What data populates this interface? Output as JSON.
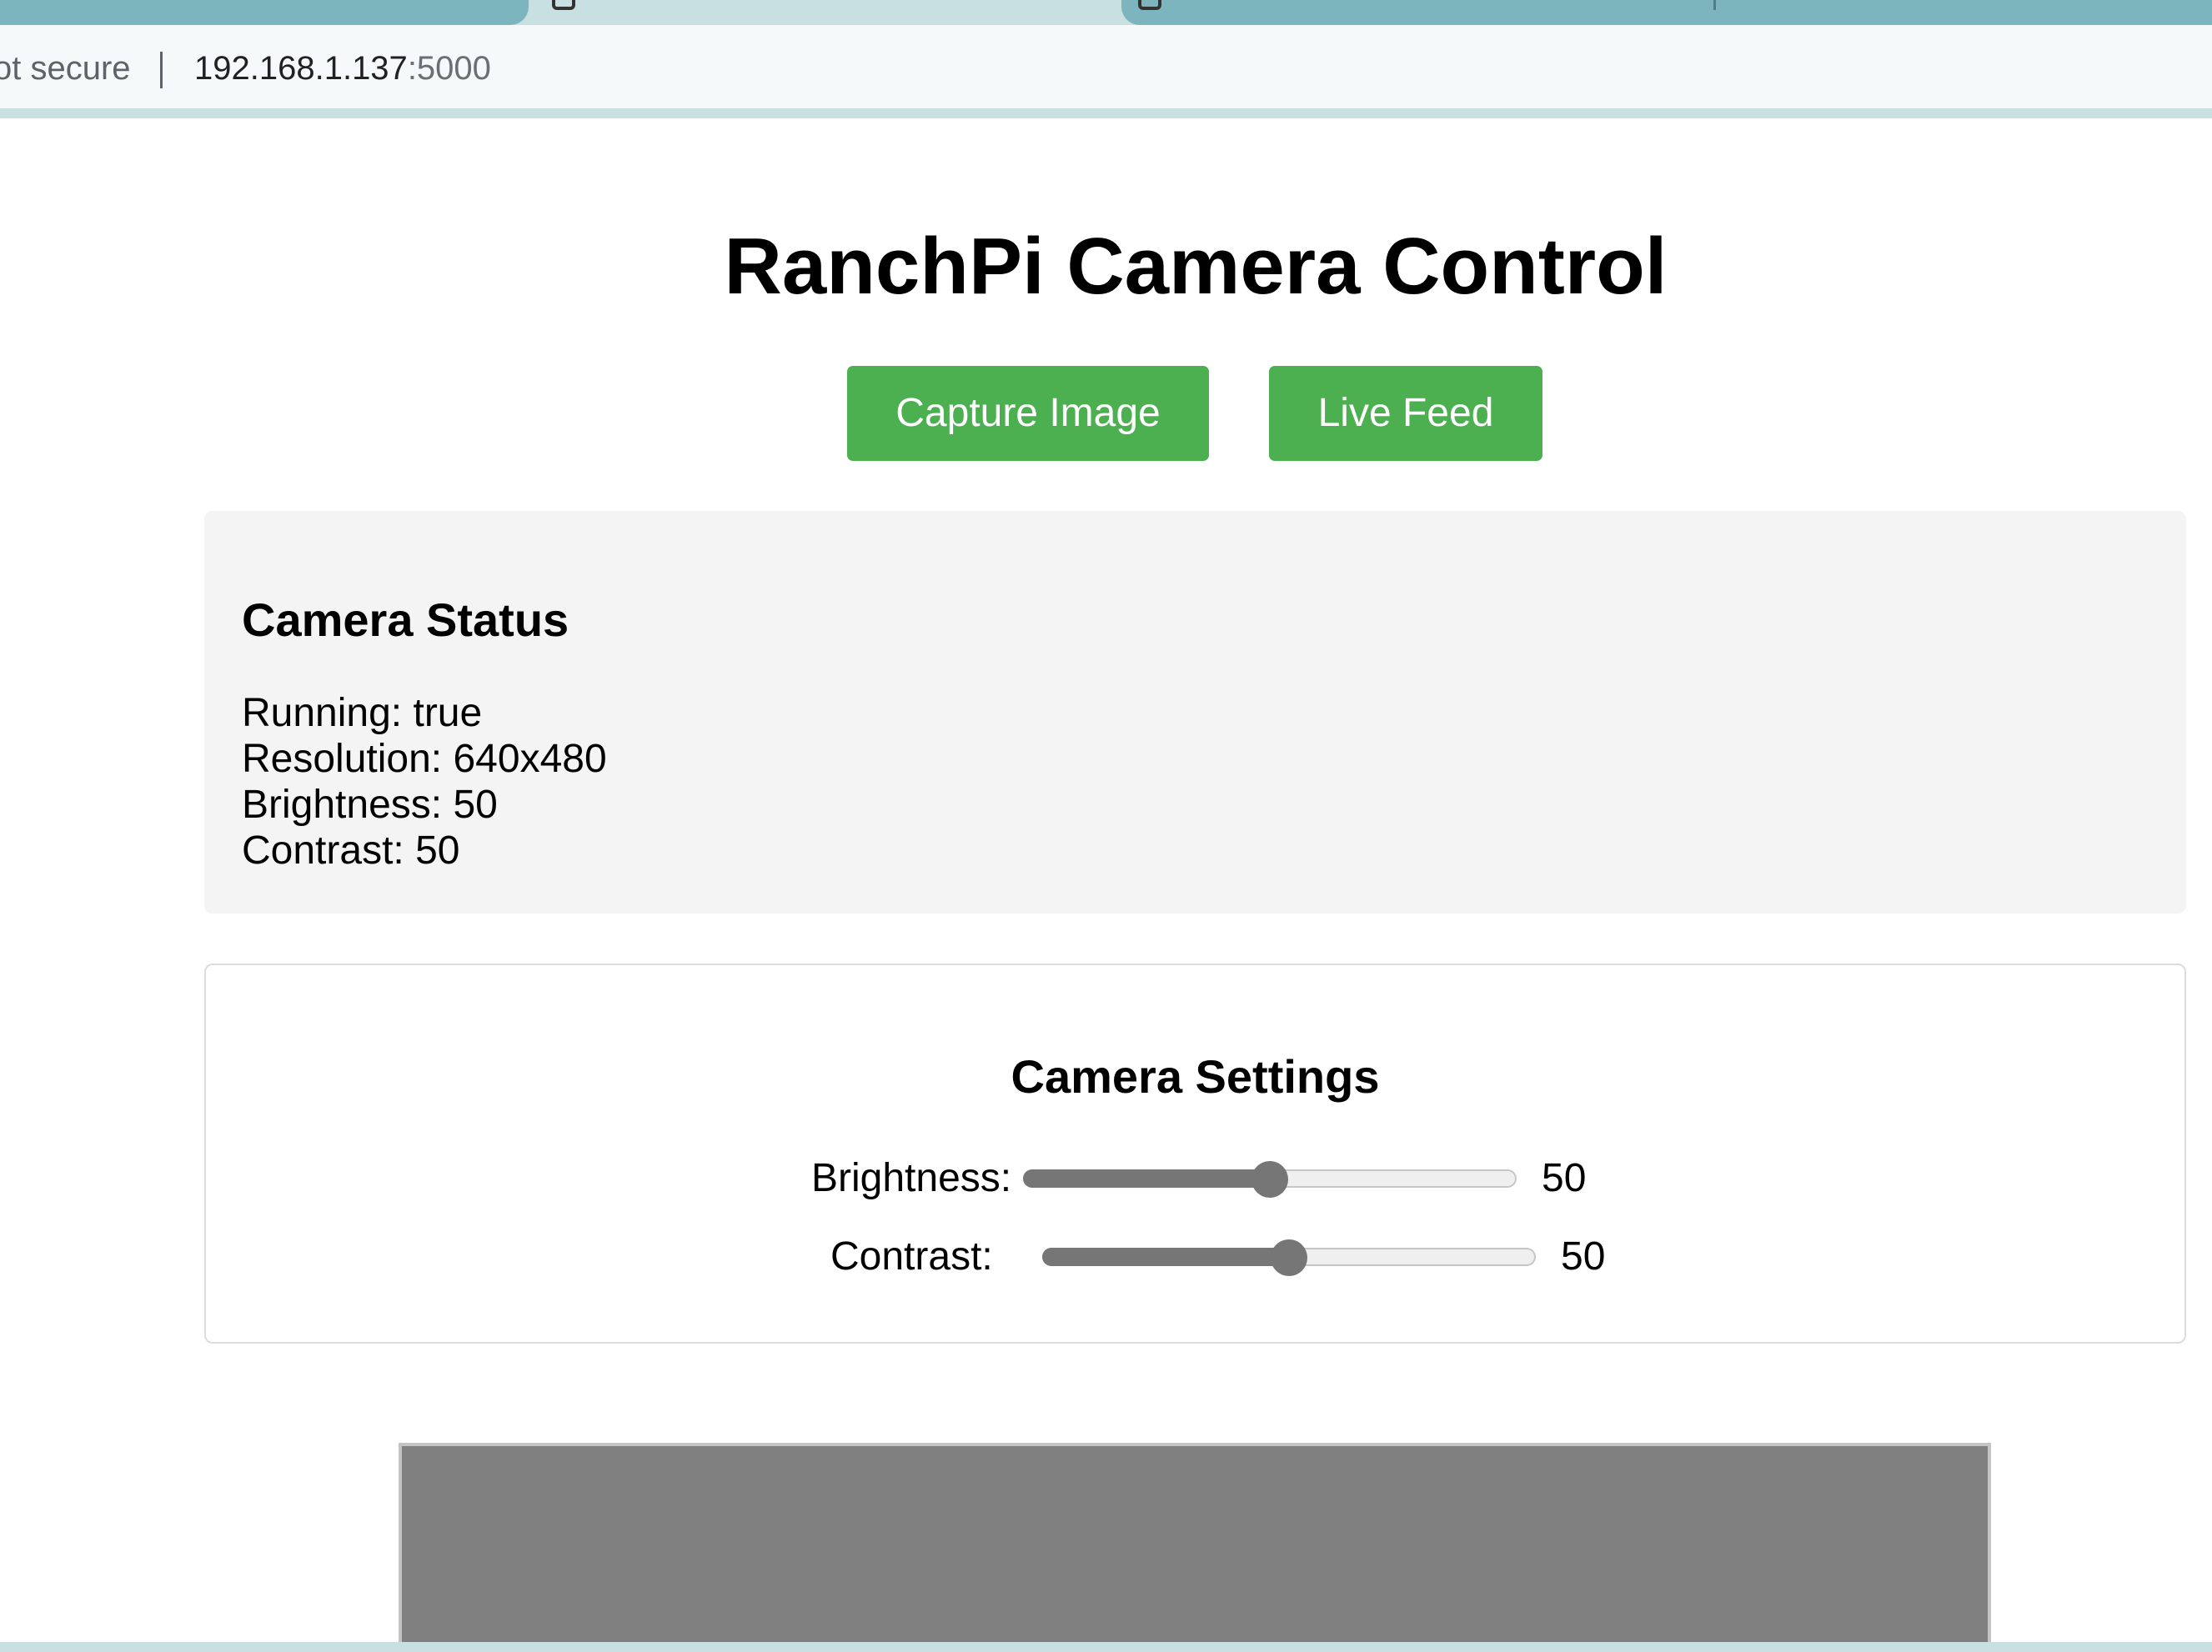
{
  "browser": {
    "security_label": "ot secure",
    "url_host": "192.168.1.137",
    "url_port": ":5000",
    "tab_separator_color": "#7cb5be"
  },
  "page": {
    "title": "RanchPi Camera Control",
    "buttons": {
      "capture_label": "Capture Image",
      "live_label": "Live Feed",
      "accent_color": "#4caf50"
    },
    "status": {
      "heading": "Camera Status",
      "running": "Running: true",
      "resolution": "Resolution: 640x480",
      "brightness": "Brightness: 50",
      "contrast": "Contrast: 50"
    },
    "settings": {
      "heading": "Camera Settings",
      "brightness": {
        "label": "Brightness:",
        "value": 50,
        "value_text": "50",
        "min": 0,
        "max": 100
      },
      "contrast": {
        "label": "Contrast:",
        "value": 50,
        "value_text": "50",
        "min": 0,
        "max": 100
      }
    }
  }
}
